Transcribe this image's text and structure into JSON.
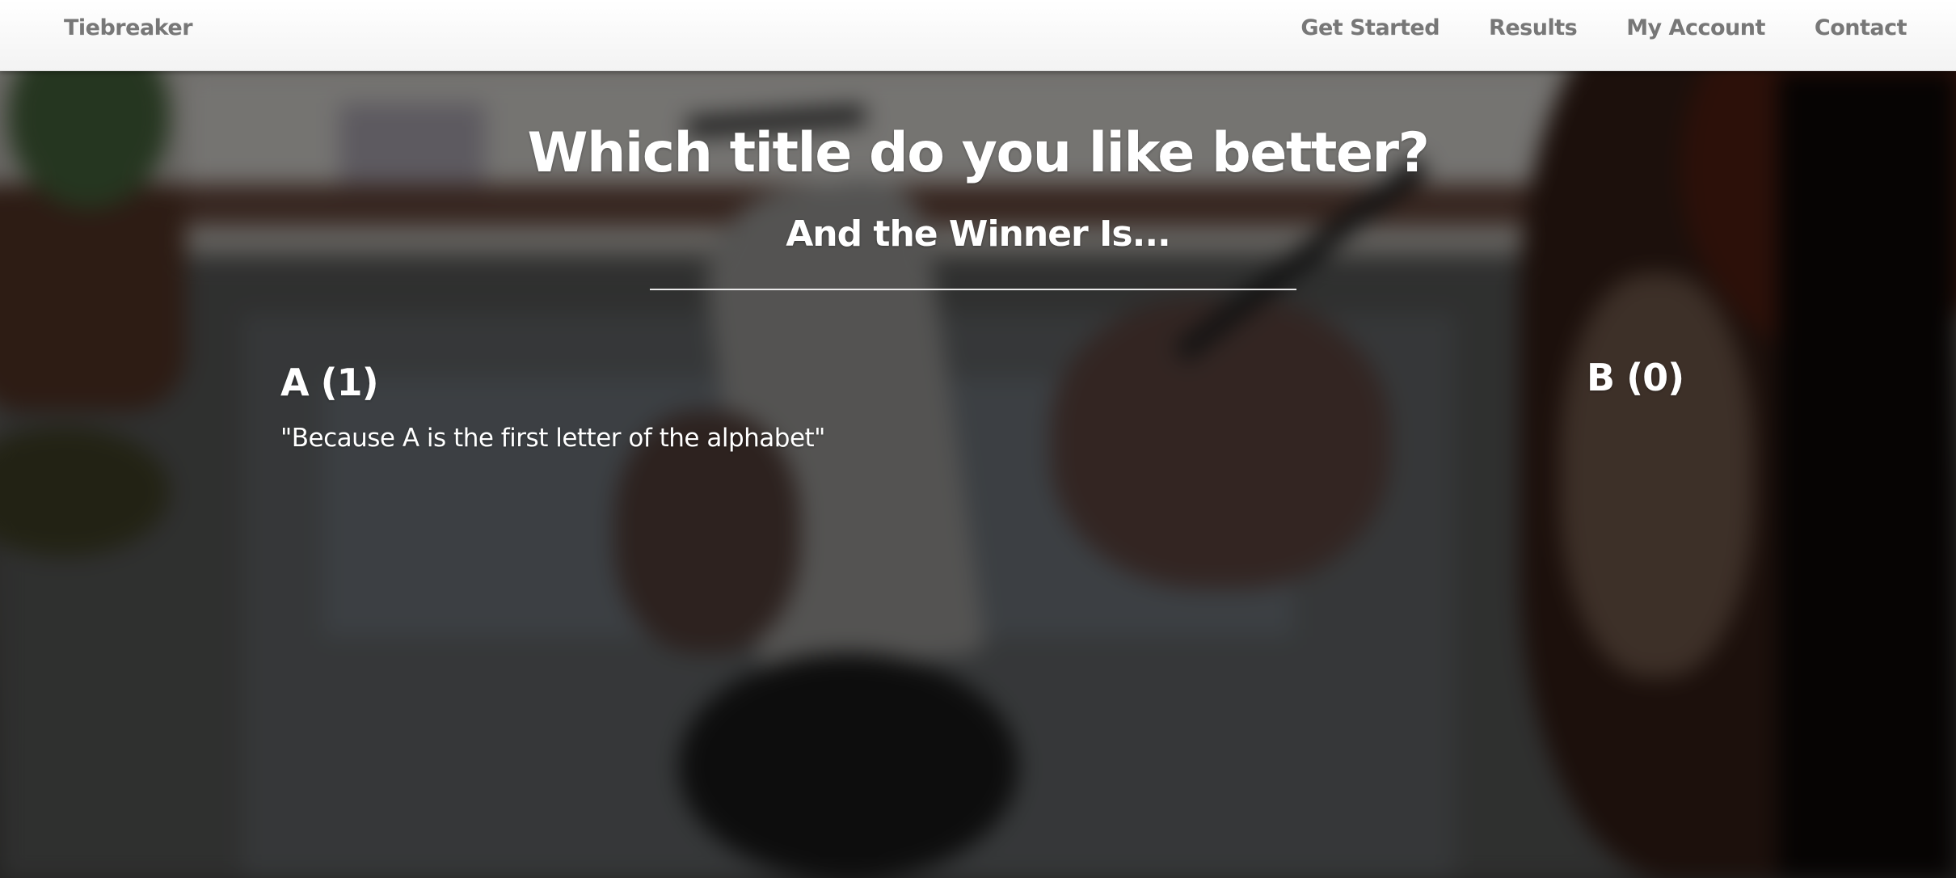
{
  "navbar": {
    "brand": "Tiebreaker",
    "links": [
      "Get Started",
      "Results",
      "My Account",
      "Contact"
    ]
  },
  "hero": {
    "title": "Which title do you like better?",
    "subtitle": "And the Winner Is...",
    "option_a": {
      "heading": "A (1)",
      "reason": "\"Because A is the first letter of the alphabet\""
    },
    "option_b": {
      "heading": "B (0)"
    }
  }
}
